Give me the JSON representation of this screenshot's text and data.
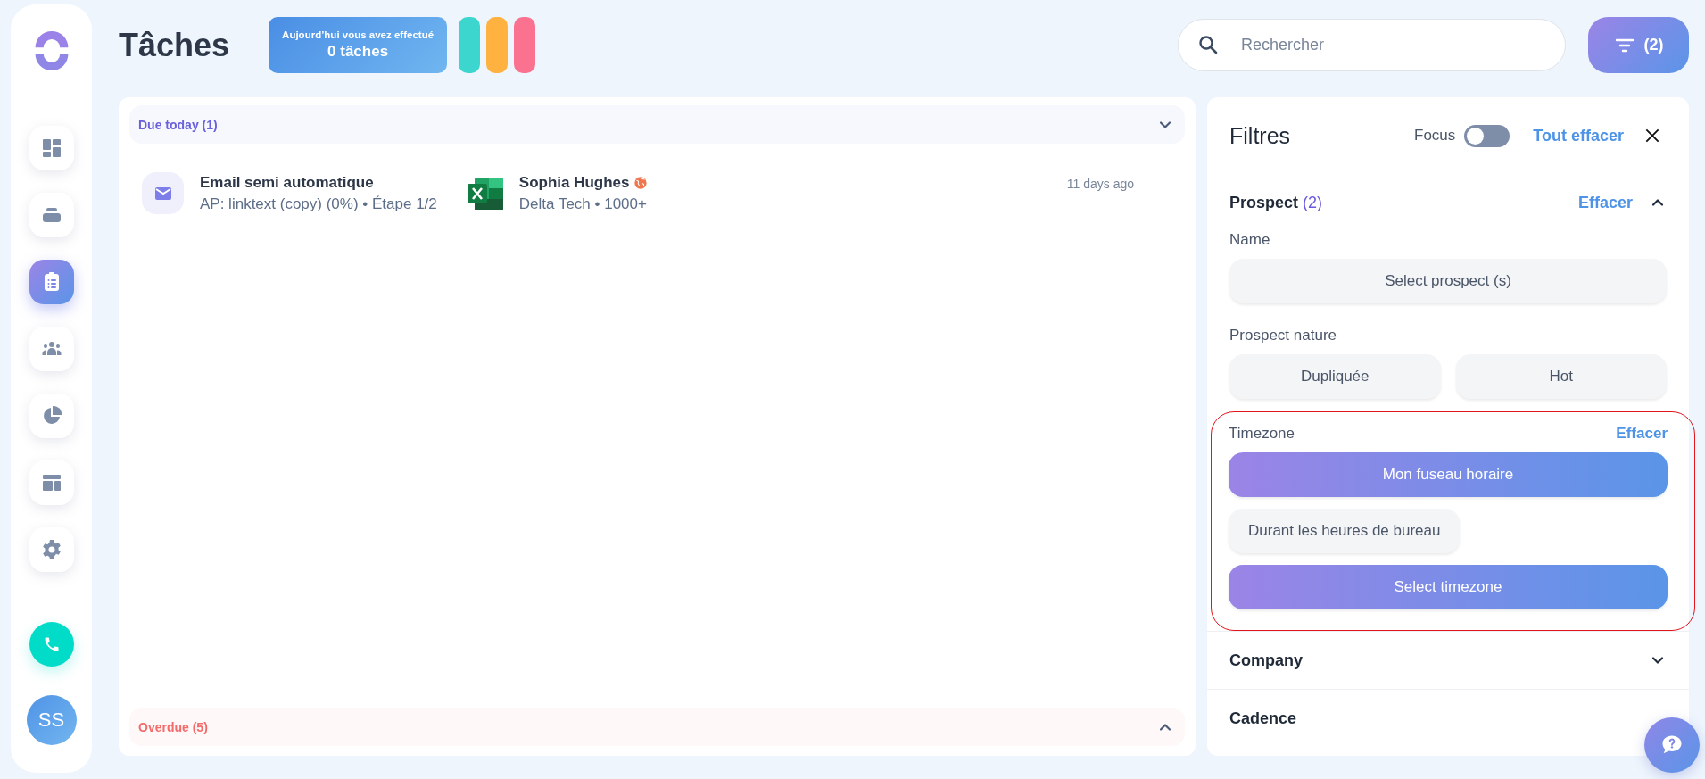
{
  "sidebar": {
    "items": [
      {
        "kind": "dashboard",
        "selected": false
      },
      {
        "kind": "inbox",
        "selected": false
      },
      {
        "kind": "tasks",
        "selected": true
      },
      {
        "kind": "team",
        "selected": false
      },
      {
        "kind": "reports",
        "selected": false
      },
      {
        "kind": "layout",
        "selected": false
      },
      {
        "kind": "settings",
        "selected": false
      }
    ],
    "avatar": "SS"
  },
  "header": {
    "title": "Tâches",
    "stats": {
      "caption": "Aujourd’hui vous avez effectué",
      "value": "0 tâches"
    },
    "bars": [
      {
        "color": "#3dd6cf"
      },
      {
        "color": "#ffb23f"
      },
      {
        "color": "#fb7290"
      }
    ]
  },
  "search": {
    "placeholder": "Rechercher"
  },
  "filter_button": {
    "count": "(2)"
  },
  "sections": [
    {
      "kind": "due",
      "title": "Due today (1)",
      "expanded": true,
      "tasks": [
        {
          "title": "Email semi automatique",
          "subtitle": "AP: linktext (copy) (0%) • Étape 1/2",
          "contact": "Sophia Hughes",
          "company": "Delta Tech • 1000+",
          "time": "11 days ago"
        }
      ]
    },
    {
      "kind": "overdue",
      "title": "Overdue (5)",
      "expanded": false
    }
  ],
  "filters": {
    "title": "Filtres",
    "focus": {
      "label": "Focus",
      "on": false
    },
    "clear_all": "Tout effacer",
    "sections": [
      {
        "title": "Prospect",
        "count": "(2)",
        "clear": "Effacer",
        "expanded": true,
        "fields": [
          {
            "label": "Name",
            "two_columns": false,
            "highlighted": false,
            "options": [
              {
                "label": "Select prospect (s)",
                "kind": "block",
                "selected": false
              }
            ]
          },
          {
            "label": "Prospect nature",
            "two_columns": true,
            "highlighted": false,
            "options": [
              {
                "label": "Dupliquée",
                "kind": "block",
                "selected": false
              },
              {
                "label": "Hot",
                "kind": "block",
                "selected": false
              }
            ]
          },
          {
            "label": "Timezone",
            "clear": "Effacer",
            "two_columns": false,
            "highlighted": true,
            "options": [
              {
                "label": "Mon fuseau horaire",
                "kind": "block",
                "selected": true
              },
              {
                "label": "Durant les heures de bureau",
                "kind": "chip",
                "selected": false
              },
              {
                "label": "Select timezone",
                "kind": "block",
                "selected": true
              }
            ]
          }
        ]
      },
      {
        "title": "Company",
        "expanded": false
      },
      {
        "title": "Cadence"
      }
    ]
  }
}
